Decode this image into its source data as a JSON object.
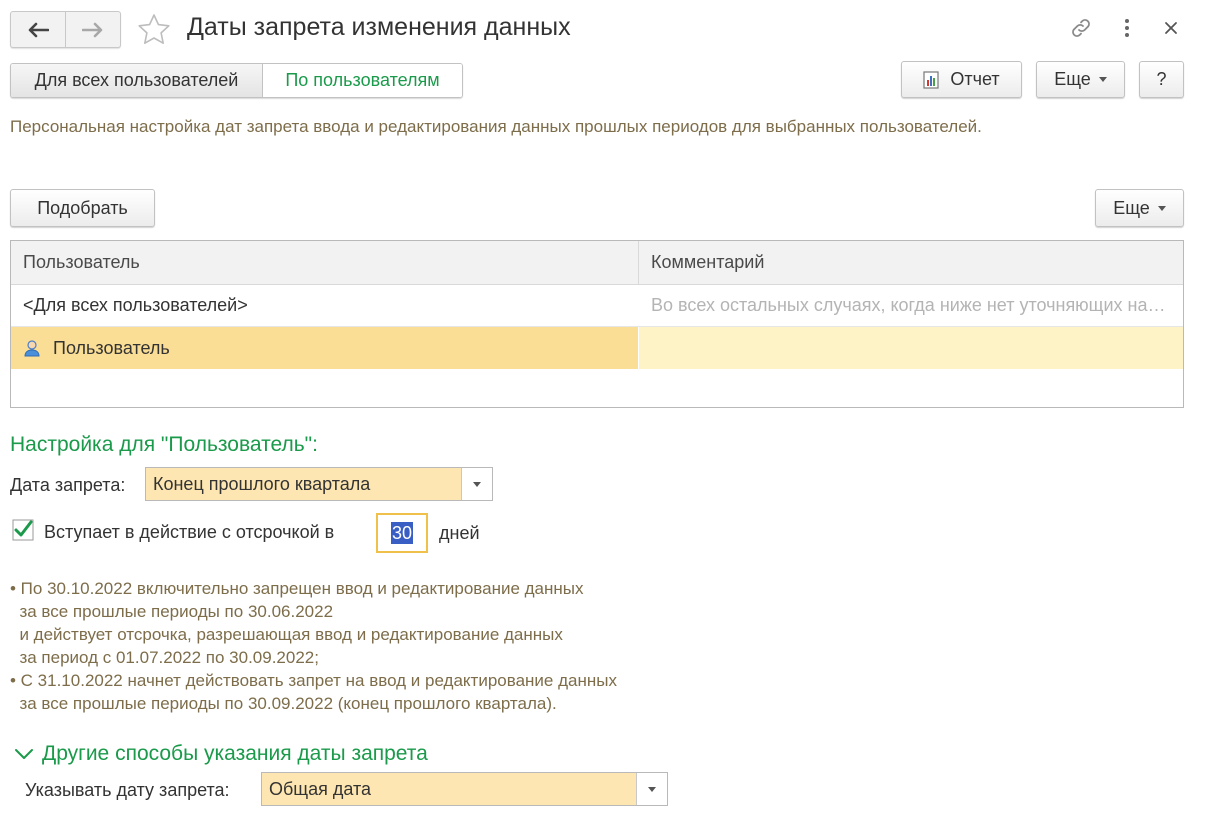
{
  "header": {
    "title": "Даты запрета изменения данных"
  },
  "mode_tabs": [
    {
      "label": "Для всех пользователей",
      "selected": false
    },
    {
      "label": "По пользователям",
      "selected": true
    }
  ],
  "toolbar": {
    "report_label": "Отчет",
    "more_label": "Еще",
    "help_label": "?"
  },
  "description": "Персональная настройка дат запрета ввода и редактирования данных прошлых периодов для выбранных пользователей.",
  "list_toolbar": {
    "pick_label": "Подобрать",
    "more_label": "Еще"
  },
  "table": {
    "columns": [
      "Пользователь",
      "Комментарий"
    ],
    "rows": [
      {
        "user": "<Для всех пользователей>",
        "comment": "Во всех остальных случаях, когда ниже нет уточняющих настроек"
      },
      {
        "user": "Пользователь",
        "comment": "",
        "selected": true,
        "icon": "user-icon"
      }
    ]
  },
  "settings": {
    "section_title": "Настройка для \"Пользователь\":",
    "ban_date_label": "Дата запрета:",
    "ban_date_value": "Конец прошлого квартала",
    "delay_checked": true,
    "delay_label": "Вступает в действие с отсрочкой в",
    "delay_days": "30",
    "delay_unit": "дней",
    "info_text": "• По 30.10.2022 включительно запрещен ввод и редактирование данных\n  за все прошлые периоды по 30.06.2022\n  и действует отсрочка, разрешающая ввод и редактирование данных\n  за период с 01.07.2022 по 30.09.2022;\n• С 31.10.2022 начнет действовать запрет на ввод и редактирование данных\n  за все прошлые периоды по 30.09.2022 (конец прошлого квартала)."
  },
  "other_methods": {
    "title": "Другие способы указания даты запрета",
    "expanded": true,
    "specify_label": "Указывать дату запрета:",
    "specify_value": "Общая дата"
  },
  "colors": {
    "accent_green": "#1a9a4a",
    "selected_row": "#fbde95",
    "input_fill": "#fde6b1",
    "info_text": "#7d6d4a"
  }
}
